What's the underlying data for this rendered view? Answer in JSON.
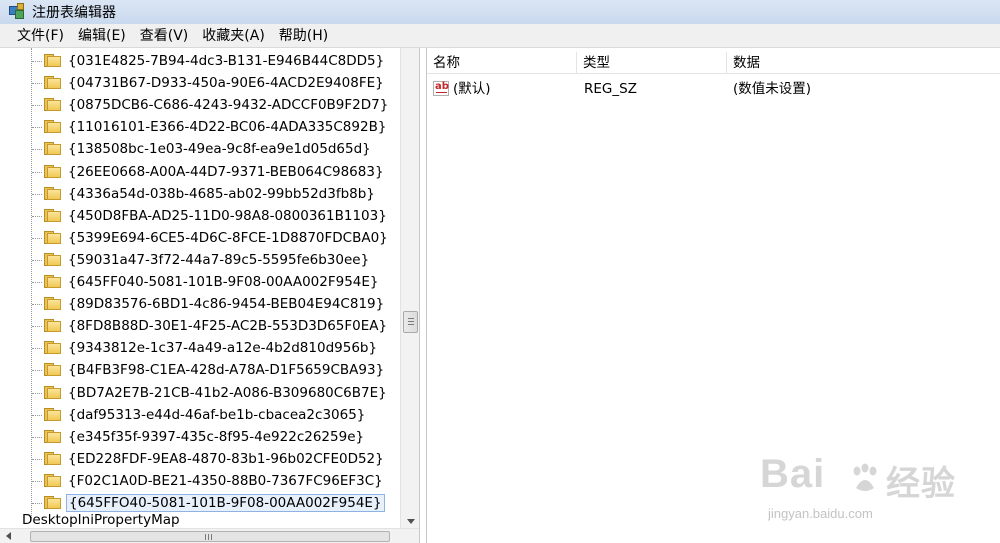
{
  "window": {
    "title": "注册表编辑器"
  },
  "menu": [
    "文件(F)",
    "编辑(E)",
    "查看(V)",
    "收藏夹(A)",
    "帮助(H)"
  ],
  "tree": {
    "items": [
      "{031E4825-7B94-4dc3-B131-E946B44C8DD5}",
      "{04731B67-D933-450a-90E6-4ACD2E9408FE}",
      "{0875DCB6-C686-4243-9432-ADCCF0B9F2D7}",
      "{11016101-E366-4D22-BC06-4ADA335C892B}",
      "{138508bc-1e03-49ea-9c8f-ea9e1d05d65d}",
      "{26EE0668-A00A-44D7-9371-BEB064C98683}",
      "{4336a54d-038b-4685-ab02-99bb52d3fb8b}",
      "{450D8FBA-AD25-11D0-98A8-0800361B1103}",
      "{5399E694-6CE5-4D6C-8FCE-1D8870FDCBA0}",
      "{59031a47-3f72-44a7-89c5-5595fe6b30ee}",
      "{645FF040-5081-101B-9F08-00AA002F954E}",
      "{89D83576-6BD1-4c86-9454-BEB04E94C819}",
      "{8FD8B88D-30E1-4F25-AC2B-553D3D65F0EA}",
      "{9343812e-1c37-4a49-a12e-4b2d810d956b}",
      "{B4FB3F98-C1EA-428d-A78A-D1F5659CBA93}",
      "{BD7A2E7B-21CB-41b2-A086-B309680C6B7E}",
      "{daf95313-e44d-46af-be1b-cbacea2c3065}",
      "{e345f35f-9397-435c-8f95-4e922c26259e}",
      "{ED228FDF-9EA8-4870-83b1-96b02CFE0D52}",
      "{F02C1A0D-BE21-4350-88B0-7367FC96EF3C}",
      "{645FFO40-5081-101B-9F08-00AA002F954E}"
    ],
    "selected_index": 20,
    "root_label": "DesktopIniPropertyMap"
  },
  "columns": {
    "name": "名称",
    "type": "类型",
    "data": "数据"
  },
  "values": [
    {
      "name": "(默认)",
      "type": "REG_SZ",
      "data": "(数值未设置)",
      "icon": "ab-string-icon"
    }
  ],
  "watermark": {
    "brand": "Bai",
    "brand2": "经验",
    "url": "jingyan.baidu.com"
  },
  "colors": {
    "titlebar": "#dbe6f4",
    "selection_border": "#8fb2e4",
    "folder": "#f0c955"
  }
}
